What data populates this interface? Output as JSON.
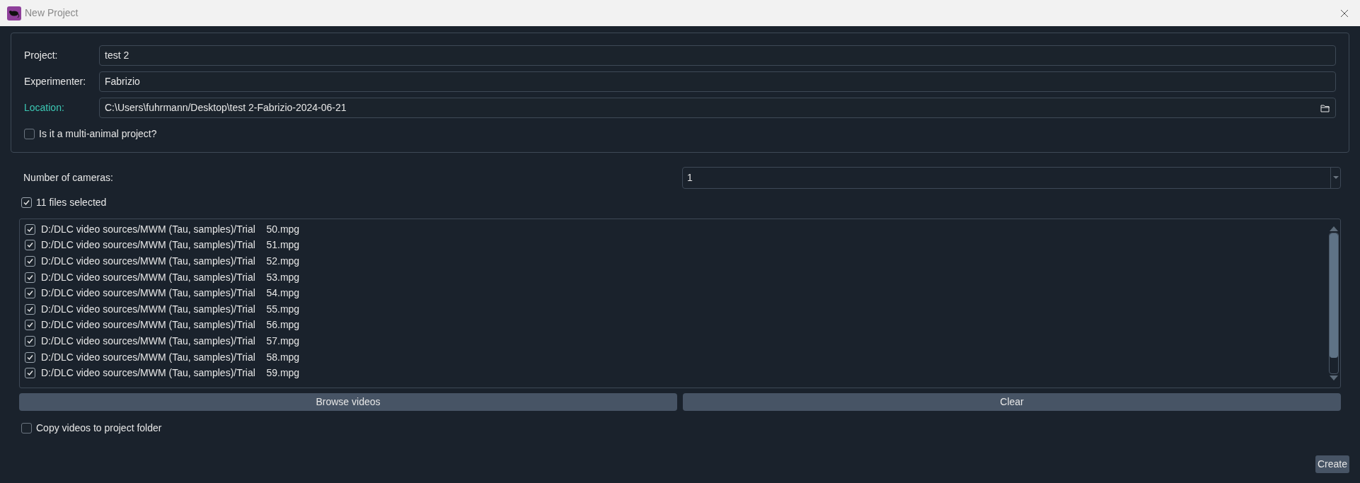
{
  "window": {
    "title": "New Project"
  },
  "project_group": {
    "fields": [
      {
        "label": "Project:",
        "value": "test 2",
        "highlighted": false,
        "browse": false
      },
      {
        "label": "Experimenter:",
        "value": "Fabrizio",
        "highlighted": false,
        "browse": false
      },
      {
        "label": "Location:",
        "value": "C:\\Users\\fuhrmann/Desktop\\test 2-Fabrizio-2024-06-21",
        "highlighted": true,
        "browse": true
      }
    ],
    "multi_animal": {
      "label": "Is it a multi-animal project?",
      "checked": false
    }
  },
  "cameras": {
    "label": "Number of cameras:",
    "value": "1"
  },
  "files_selected": {
    "label": "11 files selected",
    "checked": true
  },
  "files": [
    {
      "path": "D:/DLC video sources/MWM (Tau, samples)/Trial    50.mpg",
      "checked": true
    },
    {
      "path": "D:/DLC video sources/MWM (Tau, samples)/Trial    51.mpg",
      "checked": true
    },
    {
      "path": "D:/DLC video sources/MWM (Tau, samples)/Trial    52.mpg",
      "checked": true
    },
    {
      "path": "D:/DLC video sources/MWM (Tau, samples)/Trial    53.mpg",
      "checked": true
    },
    {
      "path": "D:/DLC video sources/MWM (Tau, samples)/Trial    54.mpg",
      "checked": true
    },
    {
      "path": "D:/DLC video sources/MWM (Tau, samples)/Trial    55.mpg",
      "checked": true
    },
    {
      "path": "D:/DLC video sources/MWM (Tau, samples)/Trial    56.mpg",
      "checked": true
    },
    {
      "path": "D:/DLC video sources/MWM (Tau, samples)/Trial    57.mpg",
      "checked": true
    },
    {
      "path": "D:/DLC video sources/MWM (Tau, samples)/Trial    58.mpg",
      "checked": true
    },
    {
      "path": "D:/DLC video sources/MWM (Tau, samples)/Trial    59.mpg",
      "checked": true
    }
  ],
  "buttons": [
    "Browse videos",
    "Clear"
  ],
  "copy_videos": {
    "label": "Copy videos to project folder",
    "checked": false
  },
  "create_button": "Create"
}
